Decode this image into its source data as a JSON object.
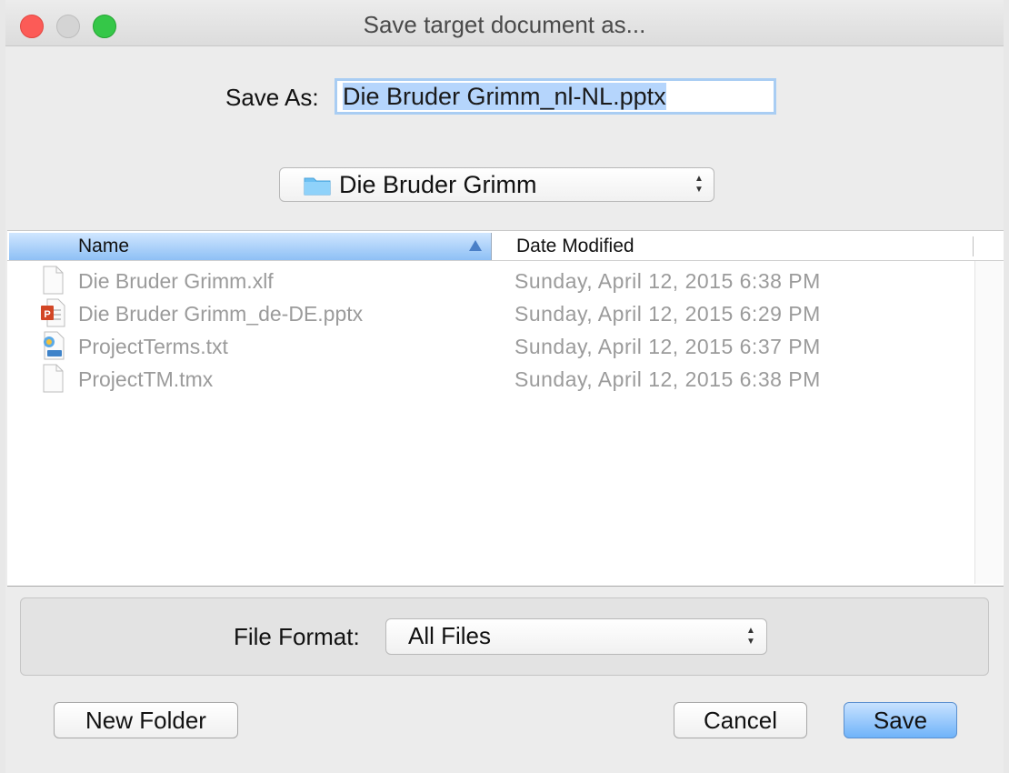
{
  "window": {
    "title": "Save target document as..."
  },
  "save_as": {
    "label": "Save As:",
    "value": "Die Bruder Grimm_nl-NL.pptx"
  },
  "location": {
    "folder": "Die Bruder Grimm",
    "icon": "folder-icon"
  },
  "file_list": {
    "columns": {
      "name": "Name",
      "date": "Date Modified"
    },
    "sort": "name-ascending",
    "rows": [
      {
        "name": "Die Bruder Grimm.xlf",
        "date": "Sunday, April 12, 2015 6:38 PM",
        "icon": "document-icon"
      },
      {
        "name": "Die Bruder Grimm_de-DE.pptx",
        "date": "Sunday, April 12, 2015 6:29 PM",
        "icon": "powerpoint-icon"
      },
      {
        "name": "ProjectTerms.txt",
        "date": "Sunday, April 12, 2015 6:37 PM",
        "icon": "text-file-icon"
      },
      {
        "name": "ProjectTM.tmx",
        "date": "Sunday, April 12, 2015 6:38 PM",
        "icon": "document-icon"
      }
    ]
  },
  "file_format": {
    "label": "File Format:",
    "value": "All Files"
  },
  "buttons": {
    "new_folder": "New Folder",
    "cancel": "Cancel",
    "save": "Save"
  },
  "colors": {
    "selection": "#b5d5fc",
    "header_sort": "#8ec0f5",
    "default_button": "#6fb3f9",
    "close": "#fc5b57",
    "maximize": "#35c748"
  }
}
